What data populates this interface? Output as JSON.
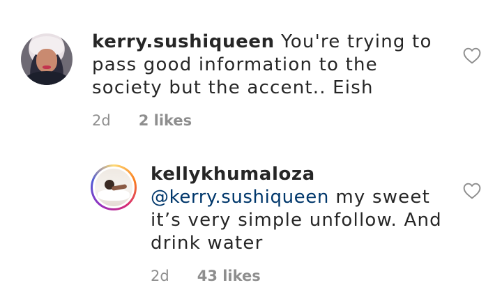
{
  "comments": [
    {
      "username": "kerry.sushiqueen",
      "text": "You're trying to pass good information to the society but the accent.. Eish",
      "time": "2d",
      "likes": "2 likes",
      "icons": {
        "avatar": "profile-photo",
        "like": "heart-outline-icon"
      }
    },
    {
      "username": "kellykhumaloza",
      "mention": "@kerry.sushiqueen",
      "text": "my sweet it’s very simple unfollow. And drink water",
      "time": "2d",
      "likes": "43 likes",
      "icons": {
        "avatar": "profile-photo-story-ring",
        "like": "heart-outline-icon"
      }
    }
  ],
  "colors": {
    "text": "#262626",
    "muted": "#8e8e8e",
    "mention": "#00376b"
  }
}
